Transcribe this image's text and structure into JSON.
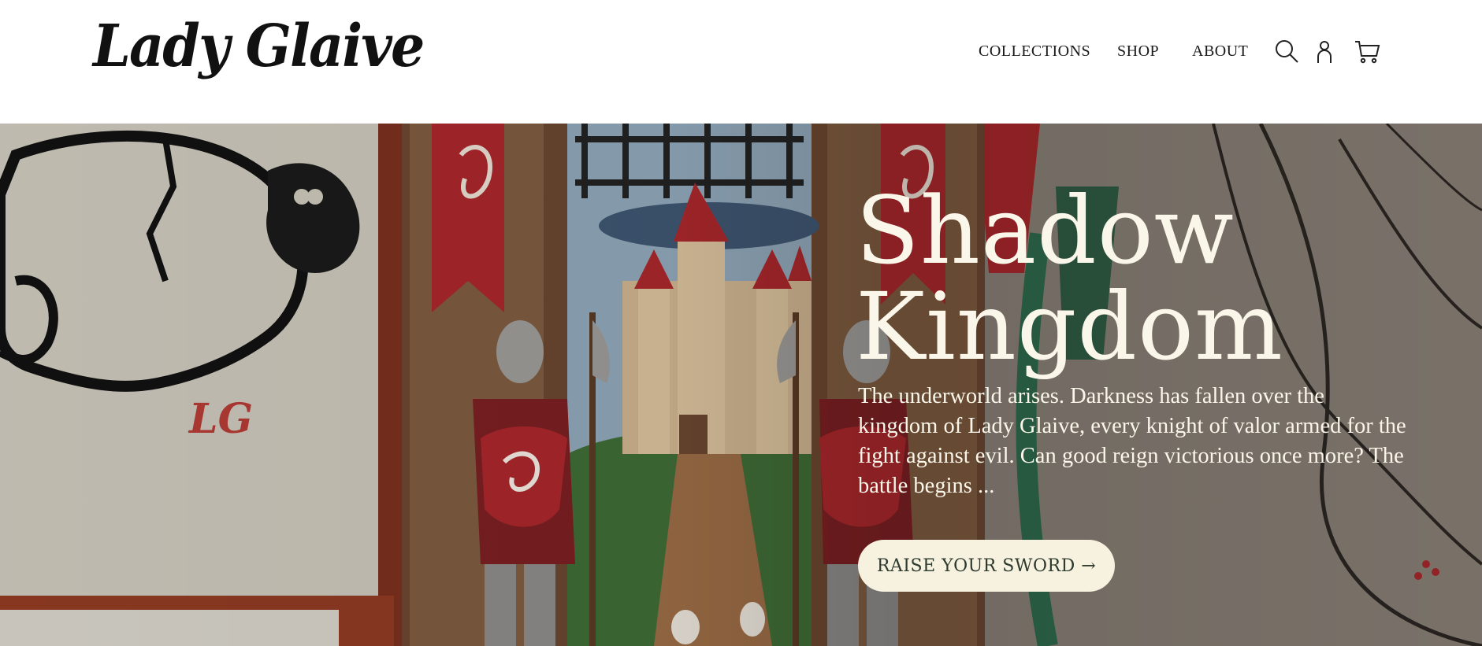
{
  "header": {
    "logo_text": "Lady Glaive",
    "nav": [
      {
        "label": "COLLECTIONS"
      },
      {
        "label": "SHOP"
      },
      {
        "label": "ABOUT"
      }
    ],
    "icons": [
      "search-icon",
      "account-icon",
      "cart-icon"
    ]
  },
  "hero": {
    "title_line1": "Shadow",
    "title_line2": "Kingdom",
    "description": "The underworld arises. Darkness has fallen over the kingdom of Lady Glaive, every knight of valor armed for the fight against evil. Can good reign victorious once more? The battle begins ...",
    "cta_label": "RAISE YOUR SWORD →",
    "monogram": "LG"
  },
  "colors": {
    "hero_text": "#fbf6ea",
    "cta_bg": "#f7f1e0",
    "cta_text": "#2d3a2e",
    "banner_red": "#a8272b",
    "tassel_green": "#2f6b4d"
  }
}
